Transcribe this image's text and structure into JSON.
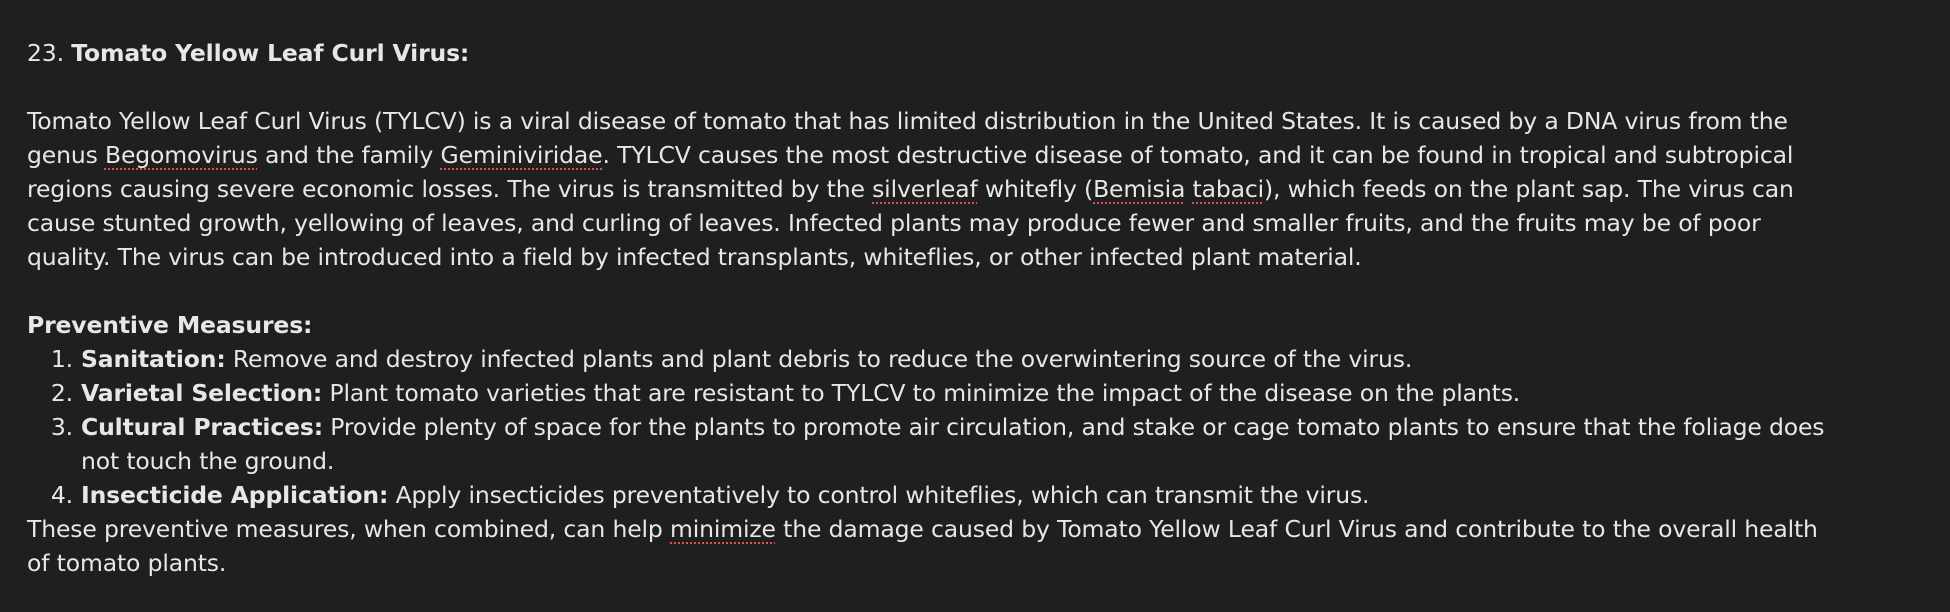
{
  "heading": {
    "number": "23.",
    "title": "Tomato Yellow Leaf Curl Virus:"
  },
  "paragraph": {
    "l1": "Tomato Yellow Leaf Curl Virus (TYLCV) is a viral disease of tomato that has limited distribution in the United States. It is caused by a DNA virus from the",
    "l2_a": "genus ",
    "l2_b": "Begomovirus",
    "l2_c": " and the family ",
    "l2_d": "Geminiviridae",
    "l2_e": ". TYLCV causes the most destructive disease of tomato, and it can be found in tropical and subtropical",
    "l3_a": "regions causing severe economic losses. The virus is transmitted by the ",
    "l3_b": "silverleaf",
    "l3_c": " whitefly (",
    "l3_d": "Bemisia",
    "l3_e": " ",
    "l3_f": "tabaci",
    "l3_g": "), which feeds on the plant sap. The virus can",
    "l4": "cause stunted growth, yellowing of leaves, and curling of leaves. Infected plants may produce fewer and smaller fruits, and the fruits may be of poor",
    "l5": "quality. The virus can be introduced into a field by infected transplants, whiteflies, or other infected plant material."
  },
  "preventive": {
    "heading": "Preventive Measures:",
    "items": [
      {
        "num": "1.",
        "term": "Sanitation:",
        "text": " Remove and destroy infected plants and plant debris to reduce the overwintering source of the virus."
      },
      {
        "num": "2.",
        "term": "Varietal Selection:",
        "text": " Plant tomato varieties that are resistant to TYLCV to minimize the impact of the disease on the plants."
      },
      {
        "num": "3.",
        "term": "Cultural Practices:",
        "text": " Provide plenty of space for the plants to promote air circulation, and stake or cage tomato plants to ensure that the foliage does",
        "text_cont": "not touch the ground."
      },
      {
        "num": "4.",
        "term": "Insecticide Application:",
        "text": " Apply insecticides preventatively to control whiteflies, which can transmit the virus."
      }
    ]
  },
  "closing": {
    "l1_a": "These preventive measures, when combined, can help ",
    "l1_b": "minimize",
    "l1_c": " the damage caused by Tomato Yellow Leaf Curl Virus and contribute to the overall health",
    "l2": "of tomato plants."
  },
  "colors": {
    "background": "#1f1f1f",
    "text": "#e7e7e7",
    "spellcheck_underline": "#e0504f"
  }
}
